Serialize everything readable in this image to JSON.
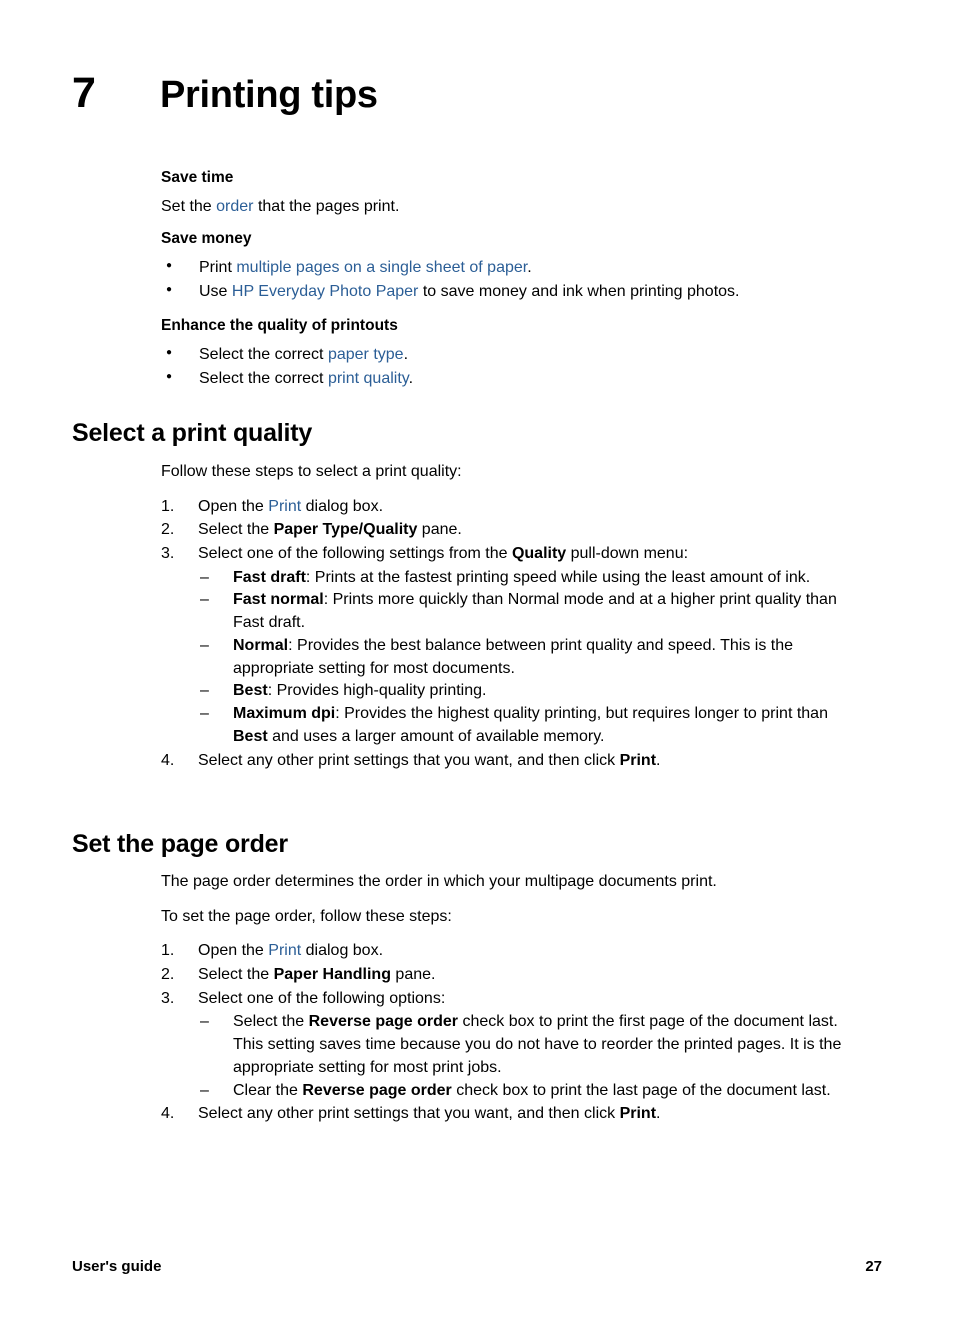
{
  "chapter": {
    "number": "7",
    "title": "Printing tips"
  },
  "intro": {
    "save_time": {
      "heading": "Save time",
      "text_before": "Set the ",
      "link": "order",
      "text_after": " that the pages print."
    },
    "save_money": {
      "heading": "Save money",
      "items": [
        {
          "before": "Print ",
          "link": "multiple pages on a single sheet of paper",
          "after": "."
        },
        {
          "before": "Use ",
          "link": "HP Everyday Photo Paper",
          "after": " to save money and ink when printing photos."
        }
      ]
    },
    "enhance_quality": {
      "heading": "Enhance the quality of printouts",
      "items": [
        {
          "before": "Select the correct ",
          "link": "paper type",
          "after": "."
        },
        {
          "before": "Select the correct ",
          "link": "print quality",
          "after": "."
        }
      ]
    }
  },
  "section_print_quality": {
    "heading": "Select a print quality",
    "intro": "Follow these steps to select a print quality:",
    "steps": [
      {
        "num": "1.",
        "before": "Open the ",
        "link": "Print",
        "after": " dialog box."
      },
      {
        "num": "2.",
        "before": "Select the ",
        "bold": "Paper Type/Quality",
        "after": " pane."
      },
      {
        "num": "3.",
        "before": "Select one of the following settings from the ",
        "bold": "Quality",
        "after": " pull-down menu:"
      },
      {
        "num": "4.",
        "before": "Select any other print settings that you want, and then click ",
        "bold": "Print",
        "after": "."
      }
    ],
    "quality_options": [
      {
        "term": "Fast draft",
        "desc": ": Prints at the fastest printing speed while using the least amount of ink."
      },
      {
        "term": "Fast normal",
        "desc": ": Prints more quickly than Normal mode and at a higher print quality than Fast draft."
      },
      {
        "term": "Normal",
        "desc": ": Provides the best balance between print quality and speed. This is the appropriate setting for most documents."
      },
      {
        "term": "Best",
        "desc": ": Provides high-quality printing."
      },
      {
        "term": "Maximum dpi",
        "desc_part1": ": Provides the highest quality printing, but requires longer to print than ",
        "desc_bold": "Best",
        "desc_part2": " and uses a larger amount of available memory."
      }
    ]
  },
  "section_page_order": {
    "heading": "Set the page order",
    "para1": "The page order determines the order in which your multipage documents print.",
    "para2": "To set the page order, follow these steps:",
    "steps": [
      {
        "num": "1.",
        "before": "Open the ",
        "link": "Print",
        "after": " dialog box."
      },
      {
        "num": "2.",
        "before": "Select the ",
        "bold": "Paper Handling",
        "after": " pane."
      },
      {
        "num": "3.",
        "before": "Select one of the following options:",
        "bold": "",
        "after": ""
      },
      {
        "num": "4.",
        "before": "Select any other print settings that you want, and then click ",
        "bold": "Print",
        "after": "."
      }
    ],
    "options": [
      {
        "before": "Select the ",
        "bold": "Reverse page order",
        "after": " check box to print the first page of the document last.",
        "note": "This setting saves time because you do not have to reorder the printed pages. It is the appropriate setting for most print jobs."
      },
      {
        "before": "Clear the ",
        "bold": "Reverse page order",
        "after": " check box to print the last page of the document last.",
        "note": ""
      }
    ]
  },
  "footer": {
    "left": "User's guide",
    "page": "27"
  },
  "colors": {
    "link": "#2B5E96",
    "text": "#000000",
    "background": "#FFFFFF"
  }
}
